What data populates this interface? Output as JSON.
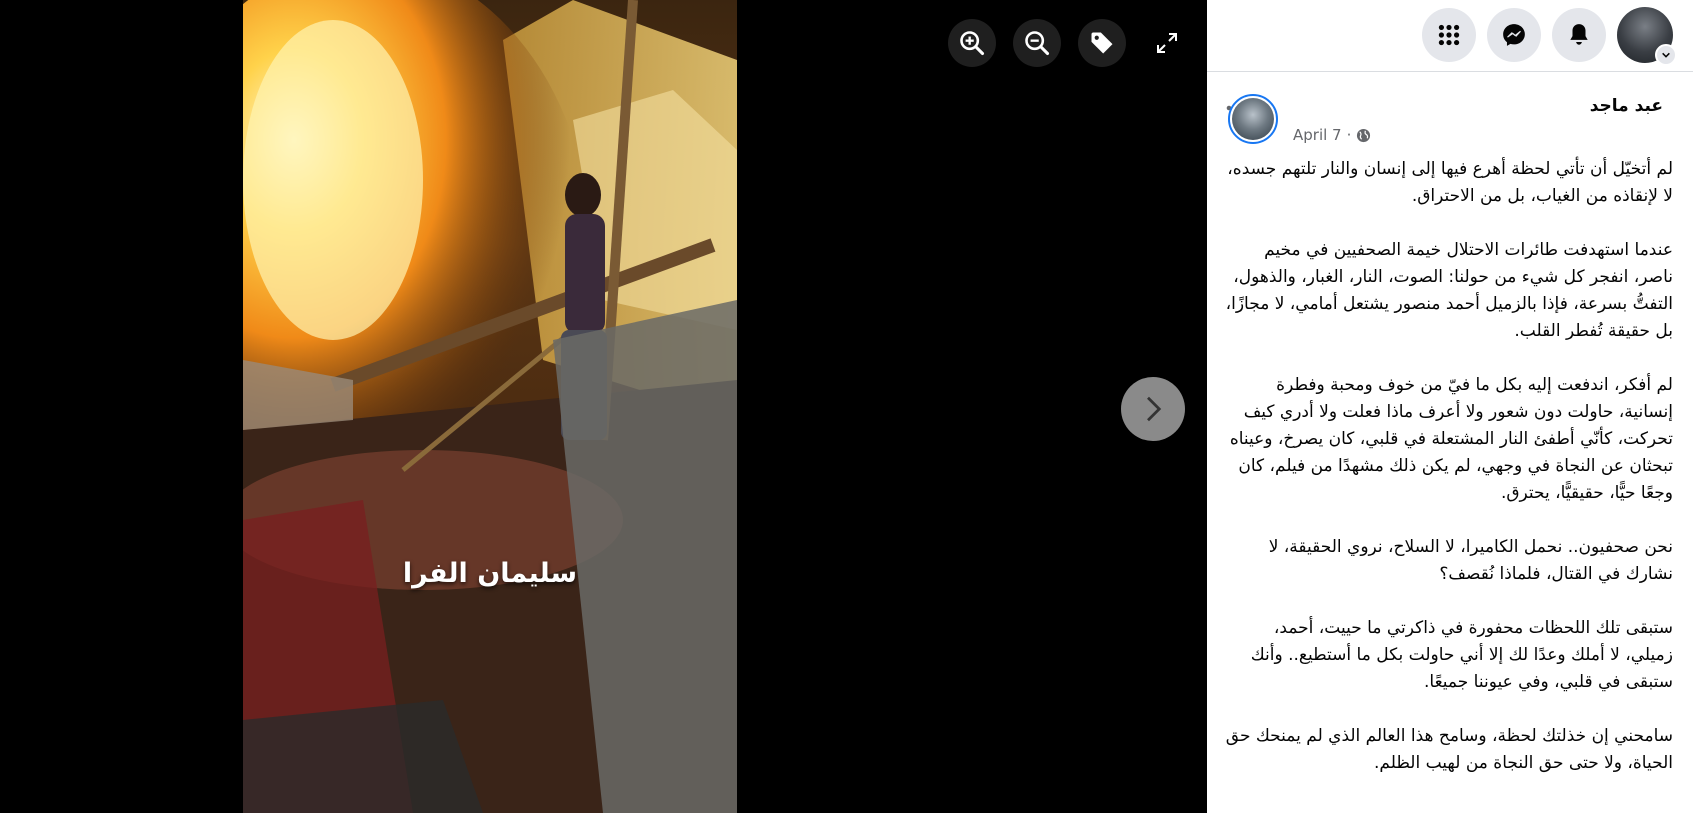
{
  "photo": {
    "caption": "سليمان الفرا"
  },
  "viewer_toolbar": {
    "icons": [
      "zoom-in-icon",
      "zoom-out-icon",
      "tag-icon",
      "fullscreen-icon"
    ],
    "next_icon": "chevron-right-icon"
  },
  "top_nav": {
    "icons": [
      "menu-grid-icon",
      "messenger-icon",
      "bell-icon",
      "account-chevron-icon"
    ]
  },
  "post": {
    "author": "عبد ماجد",
    "date": "April 7",
    "separator": "·",
    "audience_icon": "globe-icon",
    "paragraphs": [
      "لم أتخيّل أن تأتي لحظة أهرع فيها إلى إنسان والنار تلتهم جسده، لا لإنقاذه من الغياب، بل من الاحتراق.",
      "عندما استهدفت طائرات الاحتلال خيمة الصحفيين في مخيم ناصر، انفجر كل شيء من حولنا: الصوت، النار، الغبار، والذهول، التفتُّ بسرعة، فإذا بالزميل أحمد منصور يشتعل أمامي، لا مجازًا، بل حقيقة تُفطر القلب.",
      "لم أفكر، اندفعت إليه بكل ما فيّ من خوف ومحبة وفطرة إنسانية، حاولت دون شعور ولا أعرف ماذا فعلت ولا أدري كيف تحركت، كأنّي أطفئ النار المشتعلة في قلبي، كان يصرخ، وعيناه تبحثان عن النجاة في وجهي، لم يكن ذلك مشهدًا من فيلم، كان وجعًا حيًّا، حقيقيًّا، يحترق.",
      "نحن صحفيون.. نحمل الكاميرا، لا السلاح، نروي الحقيقة، لا نشارك في القتال، فلماذا نُقصف؟",
      "ستبقى تلك اللحظات محفورة في ذاكرتي ما حييت، أحمد، زميلي، لا أملك وعدًا لك إلا أني حاولت بكل ما أستطيع.. وأنك ستبقى في قلبي، وفي عيوننا جميعًا.",
      "سامحني إن خذلتك لحظة، وسامح هذا العالم الذي لم يمنحك حق الحياة، ولا حتى حق النجاة من لهيب الظلم."
    ]
  },
  "colors": {
    "panel_bg": "#ffffff",
    "viewer_bg": "#000000",
    "nav_button_bg": "#e4e6eb",
    "avatar_ring": "#1877f2",
    "meta_text": "#65676b"
  }
}
